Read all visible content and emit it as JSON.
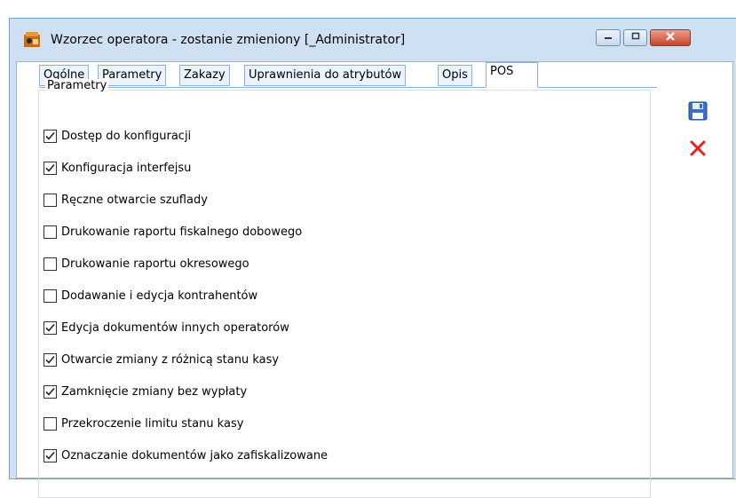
{
  "window": {
    "title": "Wzorzec operatora - zostanie zmieniony [_Administrator]"
  },
  "tabs": [
    {
      "label": "Ogólne",
      "active": false
    },
    {
      "label": "Parametry",
      "active": false
    },
    {
      "label": "Zakazy",
      "active": false
    },
    {
      "label": "Uprawnienia do atrybutów",
      "active": false
    },
    {
      "label": "Opis",
      "active": false
    },
    {
      "label": "POS",
      "active": true
    }
  ],
  "group": {
    "legend": "Parametry"
  },
  "options": [
    {
      "label": "Dostęp do konfiguracji",
      "checked": true
    },
    {
      "label": "Konfiguracja interfejsu",
      "checked": true
    },
    {
      "label": "Ręczne otwarcie szuflady",
      "checked": false
    },
    {
      "label": "Drukowanie raportu fiskalnego dobowego",
      "checked": false
    },
    {
      "label": "Drukowanie raportu okresowego",
      "checked": false
    },
    {
      "label": "Dodawanie i edycja kontrahentów",
      "checked": false
    },
    {
      "label": "Edycja dokumentów innych operatorów",
      "checked": true
    },
    {
      "label": "Otwarcie zmiany z różnicą stanu kasy",
      "checked": true
    },
    {
      "label": "Zamknięcie zmiany bez wypłaty",
      "checked": true
    },
    {
      "label": "Przekroczenie limitu stanu kasy",
      "checked": false
    },
    {
      "label": "Oznaczanie dokumentów jako zafiskalizowane",
      "checked": true
    }
  ],
  "icons": {
    "app": "operator-icon",
    "save": "save-icon",
    "cancel": "cancel-icon",
    "minimize": "minimize-icon",
    "maximize": "maximize-icon",
    "close": "close-icon"
  },
  "colors": {
    "window_frame": "#cfe0f2",
    "tab_border": "#8fb0d6",
    "cancel_red": "#e0241b",
    "save_blue": "#3b6fc4",
    "close_red": "#c9442a"
  }
}
